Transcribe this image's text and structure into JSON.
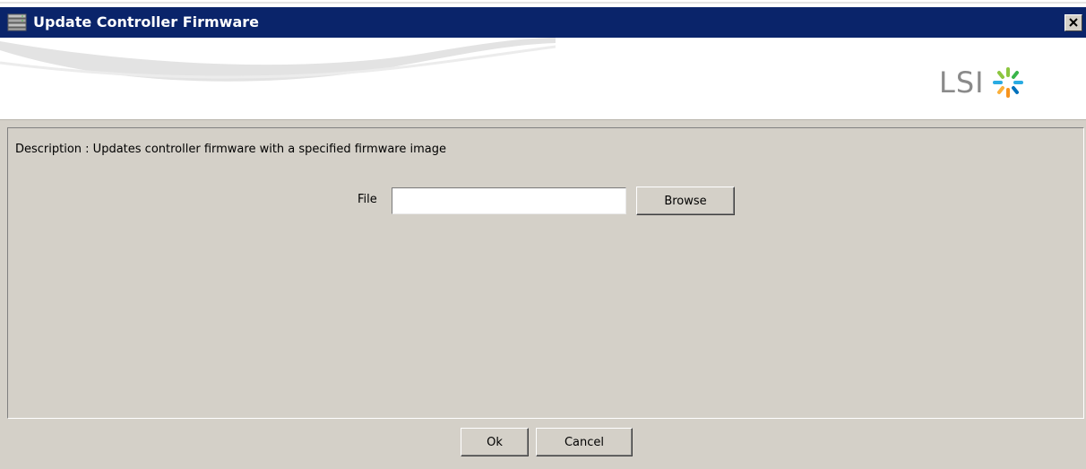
{
  "window": {
    "title": "Update Controller Firmware",
    "title_icon": "app-server-icon",
    "close_icon": "close-icon",
    "titlebar_color": "#0a246a"
  },
  "banner": {
    "logo_text": "LSI",
    "logo_icon": "lsi-starburst-icon"
  },
  "content": {
    "description": "Description : Updates controller firmware with a specified firmware image",
    "file_label": "File",
    "file_value": "",
    "browse_label": "Browse"
  },
  "footer": {
    "ok_label": "Ok",
    "cancel_label": "Cancel"
  }
}
